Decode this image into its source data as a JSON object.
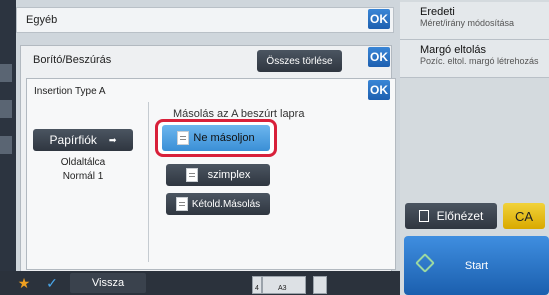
{
  "top_bar": {
    "title": "Egyéb",
    "ok": "OK"
  },
  "panel_cover": {
    "title": "Borító/Beszúrás",
    "clear_all": "Összes törlése",
    "ok": "OK"
  },
  "panel_insertion": {
    "title": "Insertion Type A",
    "ok": "OK",
    "paper_tray_button": "Papírfiók",
    "tray_info_line1": "Oldaltálca",
    "tray_info_line2": "Normál 1",
    "copy_on_insert_label": "Másolás az A beszúrt lapra",
    "options": [
      {
        "label": "Ne másoljon",
        "selected": true
      },
      {
        "label": "szimplex",
        "selected": false
      },
      {
        "label": "Kétold.Másolás",
        "selected": false
      }
    ]
  },
  "right_panel": {
    "items": [
      {
        "title": "Eredeti",
        "subtitle": "Méret/irány módosítása"
      },
      {
        "title": "Margó eltolás",
        "subtitle": "Pozíc. eltol. margó létrehozás"
      }
    ],
    "preview": "Előnézet",
    "ca": "CA",
    "start": "Start"
  },
  "bottom_bar": {
    "back": "Vissza",
    "tray_mark_1": "4",
    "tray_mark_2": "A3"
  },
  "colors": {
    "accent_blue": "#2a74c9",
    "highlight_red": "#d8203a",
    "ca_yellow": "#e6b800",
    "star_orange": "#f0a020"
  }
}
